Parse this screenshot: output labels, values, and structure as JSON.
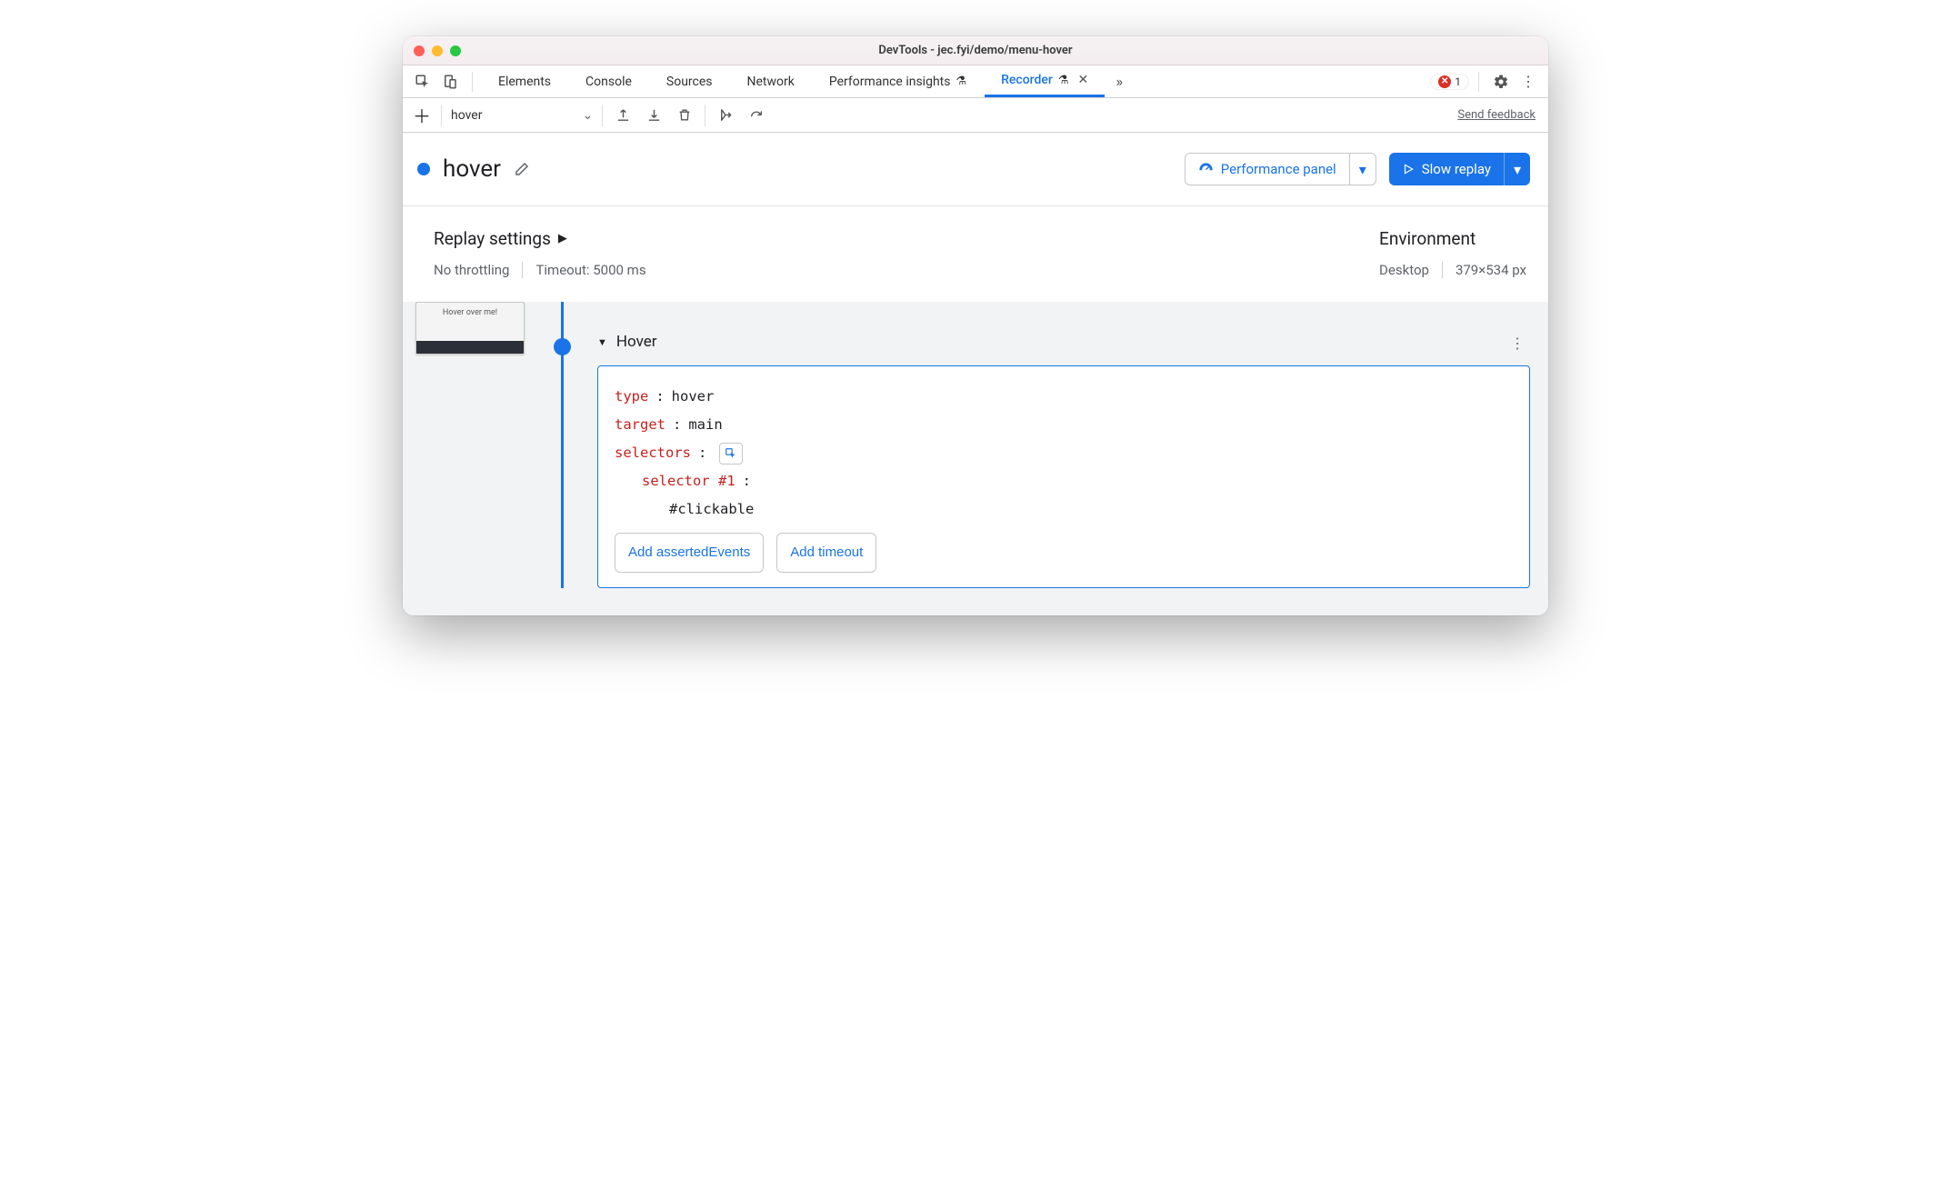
{
  "window": {
    "title": "DevTools - jec.fyi/demo/menu-hover"
  },
  "tabs": {
    "items": [
      "Elements",
      "Console",
      "Sources",
      "Network",
      "Performance insights",
      "Recorder"
    ],
    "active": "Recorder",
    "errorCount": "1"
  },
  "toolbar": {
    "recordingName": "hover",
    "feedback": "Send feedback"
  },
  "recording": {
    "title": "hover",
    "perfPanel": "Performance panel",
    "slowReplay": "Slow replay"
  },
  "settings": {
    "replayHeading": "Replay settings",
    "throttling": "No throttling",
    "timeout": "Timeout: 5000 ms",
    "envHeading": "Environment",
    "device": "Desktop",
    "viewport": "379×534 px"
  },
  "thumb": {
    "label": "Hover over me!"
  },
  "step": {
    "title": "Hover",
    "typeKey": "type",
    "typeVal": "hover",
    "targetKey": "target",
    "targetVal": "main",
    "selectorsKey": "selectors",
    "selector1Key": "selector #1",
    "selector1Val": "#clickable",
    "addAsserted": "Add assertedEvents",
    "addTimeout": "Add timeout"
  }
}
